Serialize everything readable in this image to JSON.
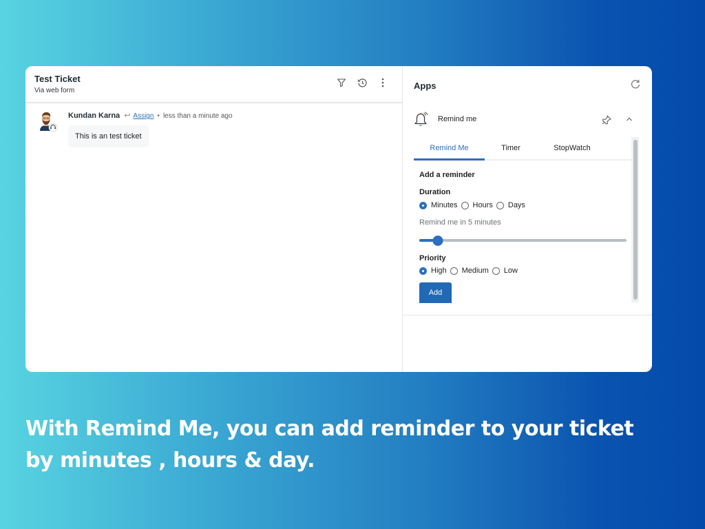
{
  "ticket": {
    "title": "Test Ticket",
    "subtitle": "Via web form",
    "header_icons": [
      "filter-icon",
      "history-icon",
      "more-vertical-icon"
    ]
  },
  "message": {
    "author": "Kundan Karna",
    "reply_icon": "reply-icon",
    "assign_label": "Assign",
    "separator": "•",
    "time": "less than a minute ago",
    "body": "This is an test ticket",
    "avatar": "agent-avatar"
  },
  "apps_panel": {
    "title": "Apps",
    "refresh_icon": "refresh-icon",
    "app": {
      "name": "Remind me",
      "icon": "bell-icon",
      "pin_icon": "pin-icon",
      "collapse_icon": "chevron-up-icon"
    },
    "tabs": [
      {
        "label": "Remind Me",
        "active": true
      },
      {
        "label": "Timer",
        "active": false
      },
      {
        "label": "StopWatch",
        "active": false
      }
    ],
    "form": {
      "heading": "Add a reminder",
      "duration_label": "Duration",
      "duration_options": [
        {
          "label": "Minutes",
          "selected": true
        },
        {
          "label": "Hours",
          "selected": false
        },
        {
          "label": "Days",
          "selected": false
        }
      ],
      "hint": "Remind me in 5 minutes",
      "slider_value_fraction": 0.09,
      "priority_label": "Priority",
      "priority_options": [
        {
          "label": "High",
          "selected": true
        },
        {
          "label": "Medium",
          "selected": false
        },
        {
          "label": "Low",
          "selected": false
        }
      ],
      "add_button": "Add"
    }
  },
  "caption": {
    "line1": "With Remind Me, you can add reminder to your ticket",
    "line2": "by minutes , hours & day."
  },
  "colors": {
    "accent": "#2c6fbf",
    "button": "#2169b5",
    "gradient_start": "#58d4e1",
    "gradient_end": "#044aab"
  }
}
